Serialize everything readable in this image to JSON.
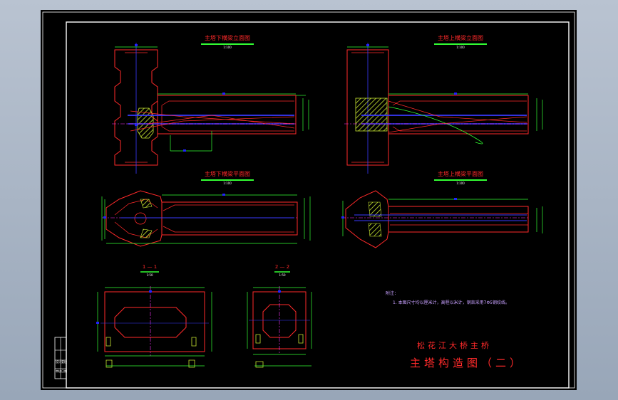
{
  "views": {
    "lower_elev": {
      "title": "主塔下横梁立面图",
      "scale": "1:100"
    },
    "upper_elev": {
      "title": "主塔上横梁立面图",
      "scale": "1:100"
    },
    "lower_plan": {
      "title": "主塔下横梁平面图",
      "scale": "1:100"
    },
    "upper_plan": {
      "title": "主塔上横梁平面图",
      "scale": "1:100"
    },
    "sec1": {
      "title": "1 — 1",
      "scale": "1:50"
    },
    "sec2": {
      "title": "2 — 2",
      "scale": "1:50"
    }
  },
  "notes": {
    "heading": "附注：",
    "line1": "1. 本图尺寸均以厘米计，高程以米计，钢束采用7Φ5钢绞线。"
  },
  "title_block": {
    "project": "松花江大桥主桥",
    "drawing": "主塔构造图（二）",
    "cells": [
      "设计",
      "复核",
      "审核",
      "日期"
    ]
  },
  "colors": {
    "sheet": "#000000",
    "outline": "#ff2a2a",
    "centerline": "#ff33ff",
    "dimension": "#33ff33",
    "tendon": "#3a3aff",
    "hatch": "#c8e632",
    "grip": "#2222ff"
  }
}
